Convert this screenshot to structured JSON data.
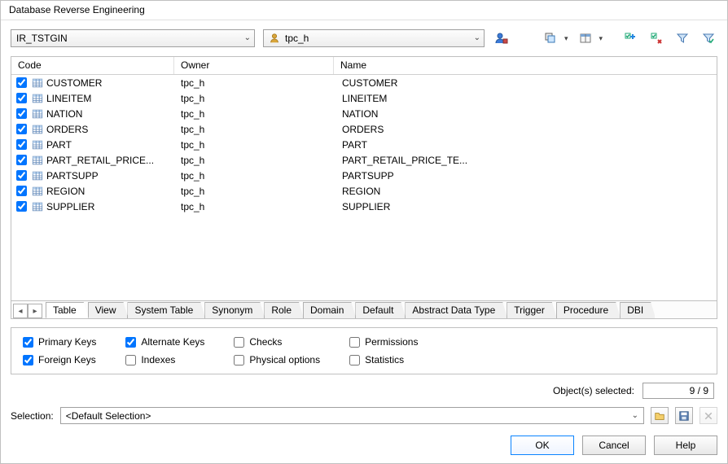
{
  "window": {
    "title": "Database Reverse Engineering"
  },
  "top": {
    "connection": "IR_TSTGIN",
    "schema": "tpc_h"
  },
  "columns": {
    "code": "Code",
    "owner": "Owner",
    "name": "Name"
  },
  "rows": [
    {
      "checked": true,
      "code": "CUSTOMER",
      "owner": "tpc_h",
      "name": "CUSTOMER"
    },
    {
      "checked": true,
      "code": "LINEITEM",
      "owner": "tpc_h",
      "name": "LINEITEM"
    },
    {
      "checked": true,
      "code": "NATION",
      "owner": "tpc_h",
      "name": "NATION"
    },
    {
      "checked": true,
      "code": "ORDERS",
      "owner": "tpc_h",
      "name": "ORDERS"
    },
    {
      "checked": true,
      "code": "PART",
      "owner": "tpc_h",
      "name": "PART"
    },
    {
      "checked": true,
      "code": "PART_RETAIL_PRICE...",
      "owner": "tpc_h",
      "name": "PART_RETAIL_PRICE_TE..."
    },
    {
      "checked": true,
      "code": "PARTSUPP",
      "owner": "tpc_h",
      "name": "PARTSUPP"
    },
    {
      "checked": true,
      "code": "REGION",
      "owner": "tpc_h",
      "name": "REGION"
    },
    {
      "checked": true,
      "code": "SUPPLIER",
      "owner": "tpc_h",
      "name": "SUPPLIER"
    }
  ],
  "tabs": [
    "Table",
    "View",
    "System Table",
    "Synonym",
    "Role",
    "Domain",
    "Default",
    "Abstract Data Type",
    "Trigger",
    "Procedure",
    "DBI"
  ],
  "activeTab": 0,
  "options": {
    "primary_keys": {
      "label": "Primary Keys",
      "checked": true
    },
    "foreign_keys": {
      "label": "Foreign Keys",
      "checked": true
    },
    "alternate_keys": {
      "label": "Alternate Keys",
      "checked": true
    },
    "indexes": {
      "label": "Indexes",
      "checked": false
    },
    "checks": {
      "label": "Checks",
      "checked": false
    },
    "physical": {
      "label": "Physical options",
      "checked": false
    },
    "permissions": {
      "label": "Permissions",
      "checked": false
    },
    "statistics": {
      "label": "Statistics",
      "checked": false
    }
  },
  "objects_selected": {
    "label": "Object(s) selected:",
    "value": "9 / 9"
  },
  "selection": {
    "label": "Selection:",
    "value": "<Default Selection>"
  },
  "buttons": {
    "ok": "OK",
    "cancel": "Cancel",
    "help": "Help"
  }
}
